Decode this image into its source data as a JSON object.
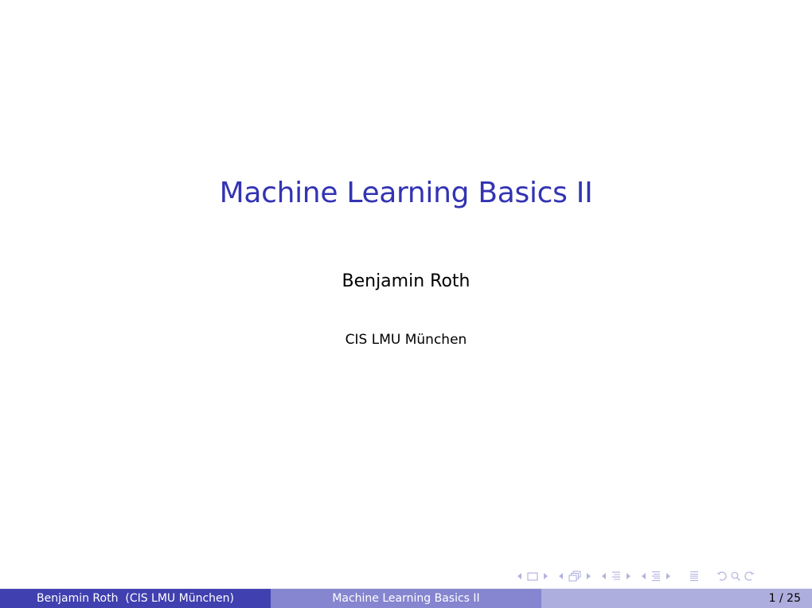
{
  "slide": {
    "title": "Machine Learning Basics II",
    "author": "Benjamin Roth",
    "institute": "CIS LMU München"
  },
  "footer": {
    "author_institute": "Benjamin Roth  (CIS LMU München)",
    "short_title": "Machine Learning Basics II",
    "current_page": 1,
    "total_pages": 25,
    "page_label": "1 / 25"
  },
  "navigation": {
    "icons": [
      "slide-nav-icon",
      "frame-nav-icon",
      "subsection-nav-icon",
      "section-nav-icon",
      "document-nav-icon",
      "back-icon",
      "search-icon",
      "forward-icon"
    ]
  },
  "colors": {
    "title": "#3333b3",
    "footer_left": "#4040b0",
    "footer_middle": "#8585d0",
    "footer_right": "#adadde",
    "nav_icons": "#b3b3e0"
  }
}
